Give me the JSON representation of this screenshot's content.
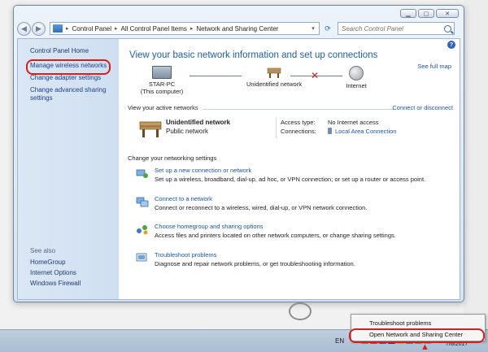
{
  "window": {
    "address_crumbs": [
      "Control Panel",
      "All Control Panel Items",
      "Network and Sharing Center"
    ],
    "search_placeholder": "Search Control Panel"
  },
  "sidebar": {
    "home": "Control Panel Home",
    "links": [
      "Manage wireless networks",
      "Change adapter settings",
      "Change advanced sharing settings"
    ],
    "see_also_header": "See also",
    "see_also": [
      "HomeGroup",
      "Internet Options",
      "Windows Firewall"
    ]
  },
  "main": {
    "heading": "View your basic network information and set up connections",
    "see_full_map": "See full map",
    "map": {
      "computer_name": "STAR-PC",
      "computer_sub": "(This computer)",
      "network_name": "Unidentified network",
      "internet": "Internet"
    },
    "active_label": "View your active networks",
    "connect_link": "Connect or disconnect",
    "active_network": {
      "name": "Unidentified network",
      "type": "Public network",
      "access_type_label": "Access type:",
      "access_type_value": "No Internet access",
      "connections_label": "Connections:",
      "connections_value": "Local Area Connection"
    },
    "change_label": "Change your networking settings",
    "tasks": [
      {
        "title": "Set up a new connection or network",
        "desc": "Set up a wireless, broadband, dial-up, ad hoc, or VPN connection; or set up a router or access point."
      },
      {
        "title": "Connect to a network",
        "desc": "Connect or reconnect to a wireless, wired, dial-up, or VPN network connection."
      },
      {
        "title": "Choose homegroup and sharing options",
        "desc": "Access files and printers located on other network computers, or change sharing settings."
      },
      {
        "title": "Troubleshoot problems",
        "desc": "Diagnose and repair network problems, or get troubleshooting information."
      }
    ]
  },
  "context_menu": {
    "items": [
      "Troubleshoot problems",
      "Open Network and Sharing Center"
    ]
  },
  "taskbar": {
    "lang": "EN",
    "date": "7/6/2017"
  },
  "colors": {
    "link": "#1b55a4",
    "heading": "#1f5fa8",
    "highlight_ring": "#d2201c",
    "sidebar_bg": "#d6e4f4"
  }
}
